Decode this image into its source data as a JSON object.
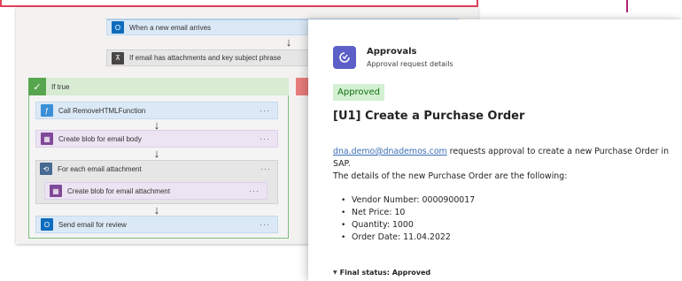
{
  "flow": {
    "trigger_label": "When a new email arrives",
    "condition_label": "If email has attachments and key subject phrase",
    "if_true_label": "If true",
    "actions": {
      "call_function": "Call RemoveHTMLFunction",
      "create_blob_body": "Create blob for email body",
      "for_each": "For each email attachment",
      "create_blob_attachment": "Create blob for email attachment",
      "send_email": "Send email for review"
    },
    "more_dots": "···",
    "arrow": "↓"
  },
  "icons": {
    "outlook": "outlook-icon",
    "condition": "condition-icon",
    "function": "function-icon",
    "blob": "blob-storage-icon",
    "loop": "loop-icon",
    "check": "check-icon",
    "approvals": "approvals-icon"
  },
  "approval": {
    "app_name": "Approvals",
    "subtitle": "Approval request details",
    "status_badge": "Approved",
    "title": "[U1] Create a Purchase Order",
    "requester_email": "dna.demo@dnademos.com",
    "request_text": " requests approval to create a new Purchase Order in",
    "request_text_2": "SAP.",
    "details_intro": "The details of the new Purchase Order are the following:",
    "details": [
      "Vendor Number: 0000900017",
      "Net Price: 10",
      "Quantity: 1000",
      "Order Date: 11.04.2022"
    ],
    "final_status": "Final status: Approved"
  },
  "colors": {
    "accent_purple": "#5b5fc7",
    "approved_green": "#0e700e",
    "approved_bg": "#d3f0d2",
    "link_blue": "#3a6fb5",
    "if_true_green": "#57a64f"
  }
}
